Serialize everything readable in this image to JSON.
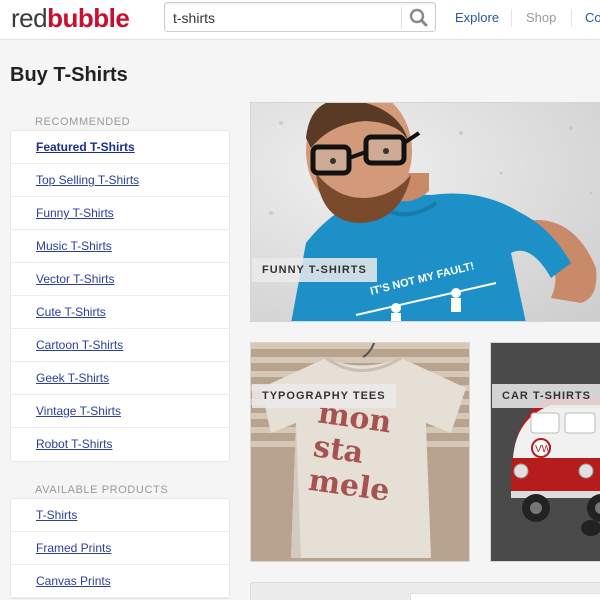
{
  "header": {
    "logo_red": "red",
    "logo_bubble": "bubble",
    "search": {
      "value": "t-shirts",
      "placeholder": ""
    },
    "nav": {
      "explore": "Explore",
      "shop": "Shop",
      "co": "Co"
    }
  },
  "page_title": "Buy T-Shirts",
  "sidebar": {
    "recommended_label": "RECOMMENDED",
    "recommended": [
      {
        "label": "Featured T-Shirts",
        "active": true
      },
      {
        "label": "Top Selling T-Shirts"
      },
      {
        "label": "Funny T-Shirts"
      },
      {
        "label": "Music T-Shirts"
      },
      {
        "label": "Vector T-Shirts"
      },
      {
        "label": "Cute T-Shirts"
      },
      {
        "label": "Cartoon T-Shirts"
      },
      {
        "label": "Geek T-Shirts"
      },
      {
        "label": "Vintage T-Shirts"
      },
      {
        "label": "Robot T-Shirts"
      }
    ],
    "products_label": "AVAILABLE PRODUCTS",
    "products": [
      {
        "label": "T-Shirts"
      },
      {
        "label": "Framed Prints"
      },
      {
        "label": "Canvas Prints"
      }
    ]
  },
  "tiles": {
    "funny": {
      "label": "FUNNY T-SHIRTS",
      "shirt_text": "IT'S NOT MY FAULT!"
    },
    "typography": {
      "label": "TYPOGRAPHY TEES",
      "shirt_text": "mon sta mele"
    },
    "car": {
      "label": "CAR T-SHIRTS"
    }
  },
  "colors": {
    "brand_red": "#c8102e",
    "link_blue": "#2a3f9e",
    "shirt_blue": "#1e90c8"
  }
}
